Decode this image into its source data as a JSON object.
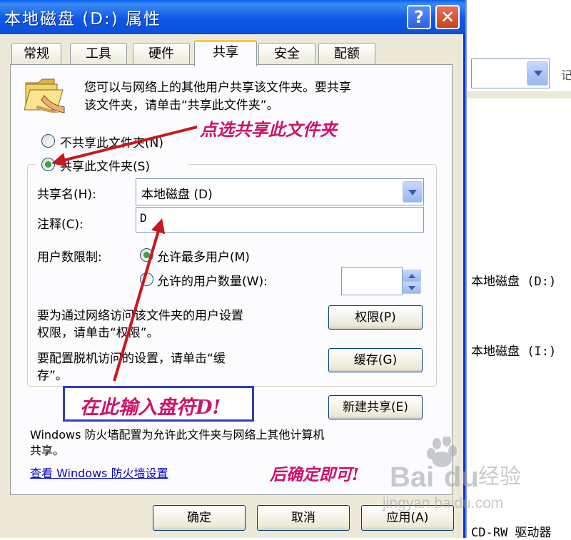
{
  "dialog": {
    "title": "本地磁盘 (D:) 属性",
    "help_button": "?",
    "close_button": "✕"
  },
  "tabs": [
    {
      "label": "常规"
    },
    {
      "label": "工具"
    },
    {
      "label": "硬件"
    },
    {
      "label": "共享",
      "selected": true
    },
    {
      "label": "安全"
    },
    {
      "label": "配额"
    }
  ],
  "sharing": {
    "intro_line1": "您可以与网络上的其他用户共享该文件夹。要共享",
    "intro_line2": "该文件夹，请单击“共享此文件夹”。",
    "radio_no_share": "不共享此文件夹(N)",
    "radio_share": "共享此文件夹(S)",
    "selected_option": "share",
    "share_name_label": "共享名(H):",
    "share_name_value": "本地磁盘 (D)",
    "comment_label": "注释(C):",
    "comment_value": "D",
    "user_limit_label": "用户数限制:",
    "radio_max_users": "允许最多用户(M)",
    "radio_allowed_users": "允许的用户数量(W):",
    "user_limit_selected": "max",
    "permissions_text_line1": "要为通过网络访问该文件夹的用户设置",
    "permissions_text_line2": "权限，请单击“权限”。",
    "permissions_button": "权限(P)",
    "caching_text_line1": "要配置脱机访问的设置，请单击“缓",
    "caching_text_line2": "存”。",
    "caching_button": "缓存(G)",
    "new_share_button": "新建共享(E)",
    "firewall_line1": "Windows 防火墙配置为允许此文件夹与网络上其他计算机",
    "firewall_line2": "共享。",
    "firewall_link": "查看 Windows 防火墙设置"
  },
  "footer": {
    "ok_button": "确定",
    "cancel_button": "取消",
    "apply_button": "应用(A)"
  },
  "annotations": {
    "select_share": "点选共享此文件夹",
    "enter_drive": "在此输入盘符D!",
    "confirm": "后确定即可!",
    "color": "#d0106a",
    "arrow_color": "#c8181e",
    "box_color": "#2f3fb8"
  },
  "background_window": {
    "toolbar_partial": "记",
    "items": [
      {
        "label": "本地磁盘 (D:)"
      },
      {
        "label": "本地磁盘 (I:)"
      },
      {
        "label": "CD-RW 驱动器"
      }
    ]
  },
  "watermark": {
    "brand": "Bai",
    "brand2": "du",
    "suffix": "经验",
    "url": "jingyan.baidu.com"
  },
  "colors": {
    "titlebar": "#0b50d8",
    "dialog_bg": "#ece9d8",
    "panel_bg": "#fcfcfe",
    "tab_highlight": "#ffc83c",
    "link": "#0000cc"
  }
}
